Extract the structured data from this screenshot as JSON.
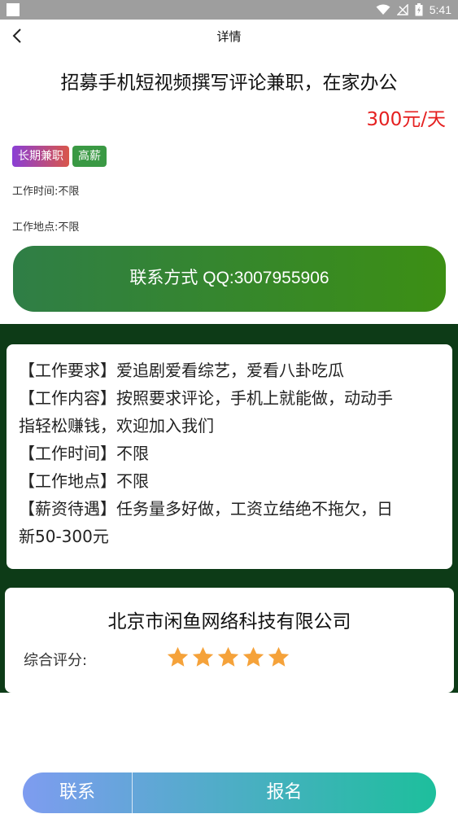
{
  "status_bar": {
    "time": "5:41"
  },
  "nav": {
    "title": "详情"
  },
  "job": {
    "title": "招募手机短视频撰写评论兼职，在家办公",
    "salary": "300元/天",
    "tags": [
      "长期兼职",
      "高薪"
    ],
    "work_time": "工作时间:不限",
    "work_place": "工作地点:不限",
    "contact_button": "联系方式 QQ:3007955906"
  },
  "description": {
    "lines": [
      "【工作要求】爱追剧爱看综艺，爱看八卦吃瓜",
      "【工作内容】按照要求评论，手机上就能做，动动手",
      "指轻松赚钱，欢迎加入我们",
      "【工作时间】不限",
      "【工作地点】不限",
      "【薪资待遇】任务量多好做，工资立结绝不拖欠，日",
      "新50-300元"
    ]
  },
  "company": {
    "name": "北京市闲鱼网络科技有限公司",
    "rating_label": "综合评分:",
    "rating": 5,
    "rating_max": 5
  },
  "bottom": {
    "contact": "联系",
    "apply": "报名"
  },
  "colors": {
    "salary": "#e52020",
    "contact_button_start": "#2f7e46",
    "contact_button_end": "#3c8f14",
    "section_background": "#0d3b17",
    "star": "#f5a23a",
    "bottom_start": "#7e9cf0",
    "bottom_end": "#1dbf9c"
  }
}
